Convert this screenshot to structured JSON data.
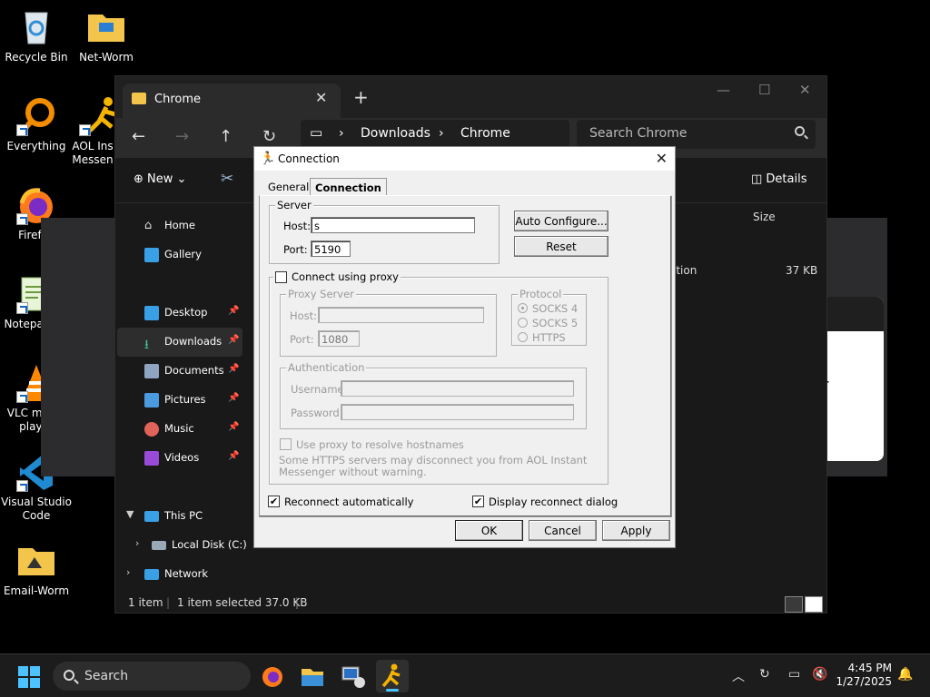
{
  "desktop": {
    "icons": [
      {
        "label": "Recycle Bin"
      },
      {
        "label": "Net-Worm"
      },
      {
        "label": "Everything"
      },
      {
        "label": "AOL Ins\nMessen"
      },
      {
        "label": "Firefox"
      },
      {
        "label": "Notepad++"
      },
      {
        "label": "VLC media player"
      },
      {
        "label": "Visual Studio Code"
      },
      {
        "label": "Email-Worm"
      }
    ],
    "background_dialog_text": "r"
  },
  "explorer": {
    "tab_title": "Chrome",
    "breadcrumb": [
      "Downloads",
      "Chrome"
    ],
    "search_placeholder": "Search Chrome",
    "toolbar": {
      "new_label": "New",
      "details_label": "Details"
    },
    "sidebar": [
      {
        "label": "Home"
      },
      {
        "label": "Gallery"
      },
      {
        "label": "Desktop"
      },
      {
        "label": "Downloads"
      },
      {
        "label": "Documents"
      },
      {
        "label": "Pictures"
      },
      {
        "label": "Music"
      },
      {
        "label": "Videos"
      },
      {
        "label": "This PC"
      },
      {
        "label": "Local Disk (C:)"
      },
      {
        "label": "Network"
      }
    ],
    "column_size": "Size",
    "file_row": {
      "name_fragment": "ation",
      "size": "37 KB"
    },
    "status": {
      "count": "1 item",
      "selected": "1 item selected 37.0 KB"
    }
  },
  "connection_dialog": {
    "title": "Connection",
    "tabs": [
      "General",
      "Connection"
    ],
    "server_group": "Server",
    "host_label": "Host:",
    "host_value": "s",
    "port_label": "Port:",
    "port_value": "5190",
    "auto_configure_label": "Auto Configure...",
    "reset_label": "Reset",
    "use_proxy_label": "Connect using proxy",
    "proxy_server_group": "Proxy Server",
    "proxy_host_label": "Host:",
    "proxy_port_label": "Port:",
    "proxy_port_value": "1080",
    "protocol_group": "Protocol",
    "protocols": [
      "SOCKS 4",
      "SOCKS 5",
      "HTTPS"
    ],
    "auth_group": "Authentication",
    "username_label": "Username:",
    "password_label": "Password:",
    "resolve_hostnames_label": "Use proxy to resolve hostnames",
    "https_note": "Some HTTPS servers may disconnect you from AOL Instant Messenger without warning.",
    "reconnect_label": "Reconnect automatically",
    "display_reconnect_label": "Display reconnect dialog",
    "ok_label": "OK",
    "cancel_label": "Cancel",
    "apply_label": "Apply"
  },
  "taskbar": {
    "search_placeholder": "Search",
    "time": "4:45 PM",
    "date": "1/27/2025"
  }
}
